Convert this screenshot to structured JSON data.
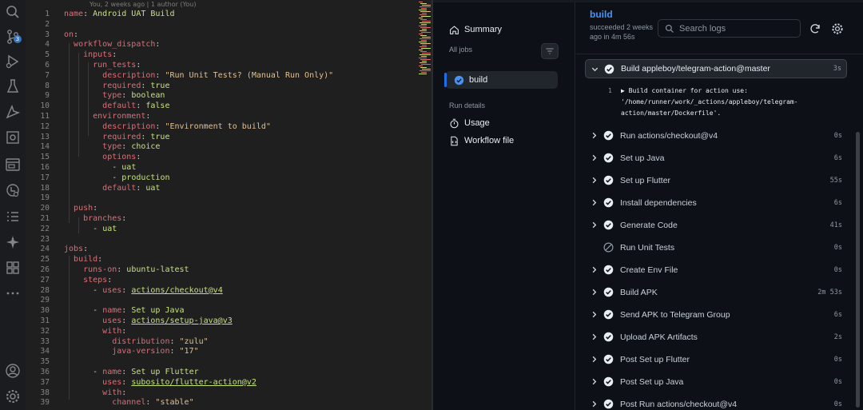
{
  "activity_bar": {
    "icons": [
      "search-icon",
      "source-control-icon",
      "run-debug-icon",
      "testing-icon",
      "remote-explorer-icon",
      "extensions-icon",
      "browser-preview-icon",
      "timeline-icon",
      "tasks-icon",
      "copilot-icon",
      "packages-icon",
      "more-icon",
      "account-icon",
      "settings-gear-icon"
    ],
    "scm_badge": "3"
  },
  "editor": {
    "blame": "You, 2 weeks ago | 1 author (You)",
    "lines": [
      {
        "n": "1",
        "c": "<span class=\"k\">name</span>: <span class=\"v\">Android UAT Build</span>"
      },
      {
        "n": "2",
        "c": ""
      },
      {
        "n": "3",
        "c": "<span class=\"k\">on</span>:"
      },
      {
        "n": "4",
        "c": "  <span class=\"k\">workflow_dispatch</span>:"
      },
      {
        "n": "5",
        "c": "    <span class=\"k\">inputs</span>:"
      },
      {
        "n": "6",
        "c": "      <span class=\"k\">run_tests</span>:"
      },
      {
        "n": "7",
        "c": "        <span class=\"k\">description</span>: <span class=\"s\">\"Run Unit Tests? (Manual Run Only)\"</span>"
      },
      {
        "n": "8",
        "c": "        <span class=\"k\">required</span>: <span class=\"v\">true</span>"
      },
      {
        "n": "9",
        "c": "        <span class=\"k\">type</span>: <span class=\"v\">boolean</span>"
      },
      {
        "n": "10",
        "c": "        <span class=\"k\">default</span>: <span class=\"v\">false</span>"
      },
      {
        "n": "11",
        "c": "      <span class=\"k\">environment</span>:"
      },
      {
        "n": "12",
        "c": "        <span class=\"k\">description</span>: <span class=\"s\">\"Environment to build\"</span>"
      },
      {
        "n": "13",
        "c": "        <span class=\"k\">required</span>: <span class=\"v\">true</span>"
      },
      {
        "n": "14",
        "c": "        <span class=\"k\">type</span>: <span class=\"v\">choice</span>"
      },
      {
        "n": "15",
        "c": "        <span class=\"k\">options</span>:"
      },
      {
        "n": "16",
        "c": "          <span class=\"p\">-</span> <span class=\"v\">uat</span>"
      },
      {
        "n": "17",
        "c": "          <span class=\"p\">-</span> <span class=\"v\">production</span>"
      },
      {
        "n": "18",
        "c": "        <span class=\"k\">default</span>: <span class=\"v\">uat</span>"
      },
      {
        "n": "19",
        "c": ""
      },
      {
        "n": "20",
        "c": "  <span class=\"k\">push</span>:"
      },
      {
        "n": "21",
        "c": "    <span class=\"k\">branches</span>:"
      },
      {
        "n": "22",
        "c": "      <span class=\"p\">-</span> <span class=\"v\">uat</span>"
      },
      {
        "n": "23",
        "c": ""
      },
      {
        "n": "24",
        "c": "<span class=\"k\">jobs</span>:"
      },
      {
        "n": "25",
        "c": "  <span class=\"k\">build</span>:"
      },
      {
        "n": "26",
        "c": "    <span class=\"k\">runs-on</span>: <span class=\"v\">ubuntu-latest</span>"
      },
      {
        "n": "27",
        "c": "    <span class=\"k\">steps</span>:"
      },
      {
        "n": "28",
        "c": "      <span class=\"p\">-</span> <span class=\"k\">uses</span>: <span class=\"u\">actions/checkout@v4</span>"
      },
      {
        "n": "29",
        "c": ""
      },
      {
        "n": "30",
        "c": "      <span class=\"p\">-</span> <span class=\"k\">name</span>: <span class=\"v\">Set up Java</span>"
      },
      {
        "n": "31",
        "c": "        <span class=\"k\">uses</span>: <span class=\"u\">actions/setup-java@v3</span>"
      },
      {
        "n": "32",
        "c": "        <span class=\"k\">with</span>:"
      },
      {
        "n": "33",
        "c": "          <span class=\"k\">distribution</span>: <span class=\"s\">\"zulu\"</span>"
      },
      {
        "n": "34",
        "c": "          <span class=\"k\">java-version</span>: <span class=\"s\">\"17\"</span>"
      },
      {
        "n": "35",
        "c": ""
      },
      {
        "n": "36",
        "c": "      <span class=\"p\">-</span> <span class=\"k\">name</span>: <span class=\"v\">Set up Flutter</span>"
      },
      {
        "n": "37",
        "c": "        <span class=\"k\">uses</span>: <span class=\"u\">subosito/flutter-action@v2</span>"
      },
      {
        "n": "38",
        "c": "        <span class=\"k\">with</span>:"
      },
      {
        "n": "39",
        "c": "          <span class=\"k\">channel</span>: <span class=\"s\">\"stable\"</span>"
      }
    ]
  },
  "sidebar": {
    "summary": "Summary",
    "all_jobs": "All jobs",
    "job": "build",
    "run_details": "Run details",
    "usage": "Usage",
    "workflow_file": "Workflow file"
  },
  "main": {
    "title": "build",
    "status": "succeeded 2 weeks ago in 4m 56s",
    "search_placeholder": "Search logs",
    "steps": [
      {
        "name": "Build appleboy/telegram-action@master",
        "time": "3s",
        "status": "success",
        "expanded": true
      },
      {
        "name": "Run actions/checkout@v4",
        "time": "0s",
        "status": "success"
      },
      {
        "name": "Set up Java",
        "time": "6s",
        "status": "success"
      },
      {
        "name": "Set up Flutter",
        "time": "55s",
        "status": "success"
      },
      {
        "name": "Install dependencies",
        "time": "6s",
        "status": "success"
      },
      {
        "name": "Generate Code",
        "time": "41s",
        "status": "success"
      },
      {
        "name": "Run Unit Tests",
        "time": "0s",
        "status": "skipped"
      },
      {
        "name": "Create Env File",
        "time": "0s",
        "status": "success"
      },
      {
        "name": "Build APK",
        "time": "2m 53s",
        "status": "success"
      },
      {
        "name": "Send APK to Telegram Group",
        "time": "6s",
        "status": "success"
      },
      {
        "name": "Upload APK Artifacts",
        "time": "2s",
        "status": "success"
      },
      {
        "name": "Post Set up Flutter",
        "time": "0s",
        "status": "success"
      },
      {
        "name": "Post Set up Java",
        "time": "0s",
        "status": "success"
      },
      {
        "name": "Post Run actions/checkout@v4",
        "time": "0s",
        "status": "success"
      }
    ],
    "log": {
      "line_number": "1",
      "text": "▶ Build container for action use:\n'/home/runner/work/_actions/appleboy/telegram-\naction/master/Dockerfile'."
    }
  },
  "colors": {
    "accent": "#4493f8",
    "success": "#e6edf3",
    "active_job_bar": "#1f6feb"
  }
}
